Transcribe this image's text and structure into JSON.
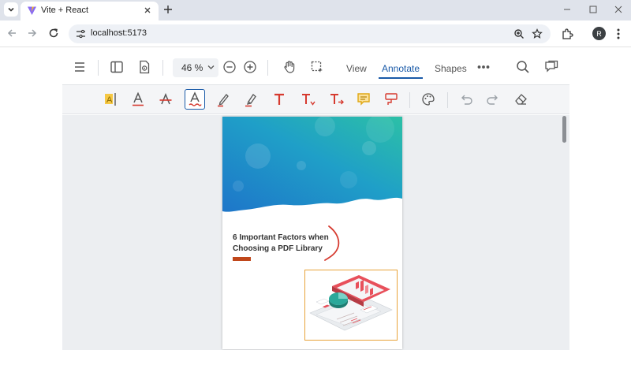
{
  "browser": {
    "tab_title": "Vite + React",
    "url": "localhost:5173",
    "profile_initial": "R"
  },
  "viewer": {
    "zoom_value": "46 %",
    "tabs": [
      {
        "label": "View",
        "active": false
      },
      {
        "label": "Annotate",
        "active": true
      },
      {
        "label": "Shapes",
        "active": false
      }
    ]
  },
  "annotation_tools": [
    "highlight-text-tool",
    "text-color-tool",
    "strikethrough-tool",
    "squiggly-underline-tool",
    "freehand-ink-tool",
    "highlighter-pen-tool",
    "free-text-tool",
    "text-insert-tool",
    "text-replace-tool",
    "sticky-note-tool",
    "callout-tool",
    "color-palette-tool",
    "undo",
    "redo",
    "eraser-tool"
  ],
  "document": {
    "title": "6 Important Factors when Choosing a PDF Library",
    "title_line1": "6 Important Factors when",
    "title_line2": "Choosing a PDF Library"
  },
  "colors": {
    "accent": "#1a5aa8",
    "ink_annotation": "#d63a2f",
    "selection_box": "#e8a33a",
    "title_accent_bar": "#c0471b"
  }
}
